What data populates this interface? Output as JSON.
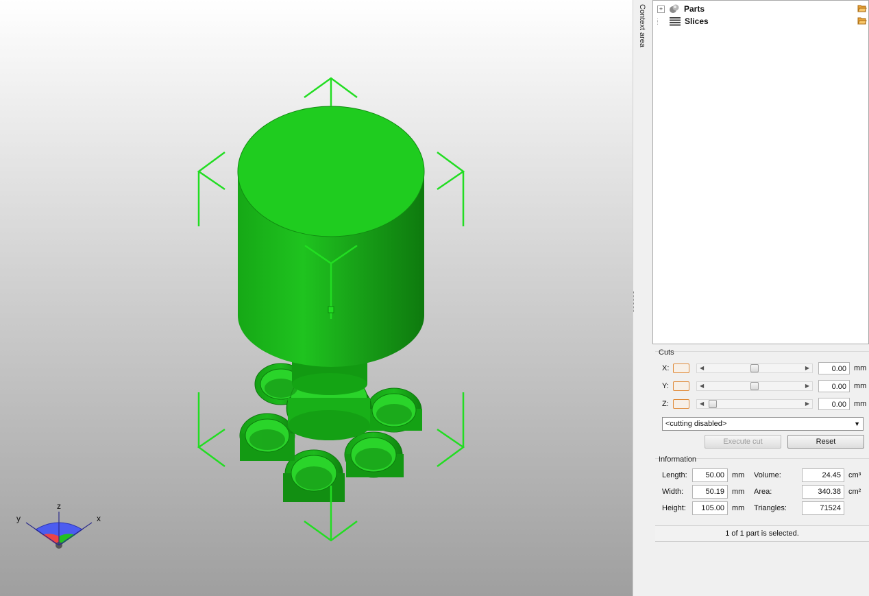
{
  "viewport": {
    "model_color": "#1fbf1f",
    "gizmo_color": "#22dd22",
    "axis_labels": {
      "x": "x",
      "y": "y",
      "z": "z"
    }
  },
  "context": {
    "label": "Context area"
  },
  "tree": {
    "items": [
      {
        "label": "Parts",
        "icon": "parts-icon",
        "expander": "+"
      },
      {
        "label": "Slices",
        "icon": "slices-icon",
        "expander": ""
      }
    ]
  },
  "cuts": {
    "title": "Cuts",
    "rows": [
      {
        "axis": "X:",
        "value": "0.00",
        "unit": "mm",
        "slider_fraction": 0.5
      },
      {
        "axis": "Y:",
        "value": "0.00",
        "unit": "mm",
        "slider_fraction": 0.5
      },
      {
        "axis": "Z:",
        "value": "0.00",
        "unit": "mm",
        "slider_fraction": 0.05
      }
    ],
    "mode_selected": "<cutting disabled>",
    "execute_label": "Execute cut",
    "reset_label": "Reset"
  },
  "info": {
    "title": "Information",
    "length_label": "Length:",
    "length_value": "50.00",
    "length_unit": "mm",
    "width_label": "Width:",
    "width_value": "50.19",
    "width_unit": "mm",
    "height_label": "Height:",
    "height_value": "105.00",
    "height_unit": "mm",
    "volume_label": "Volume:",
    "volume_value": "24.45",
    "volume_unit": "cm³",
    "area_label": "Area:",
    "area_value": "340.38",
    "area_unit": "cm²",
    "triangles_label": "Triangles:",
    "triangles_value": "71524"
  },
  "status": {
    "text": "1 of 1 part is selected."
  }
}
